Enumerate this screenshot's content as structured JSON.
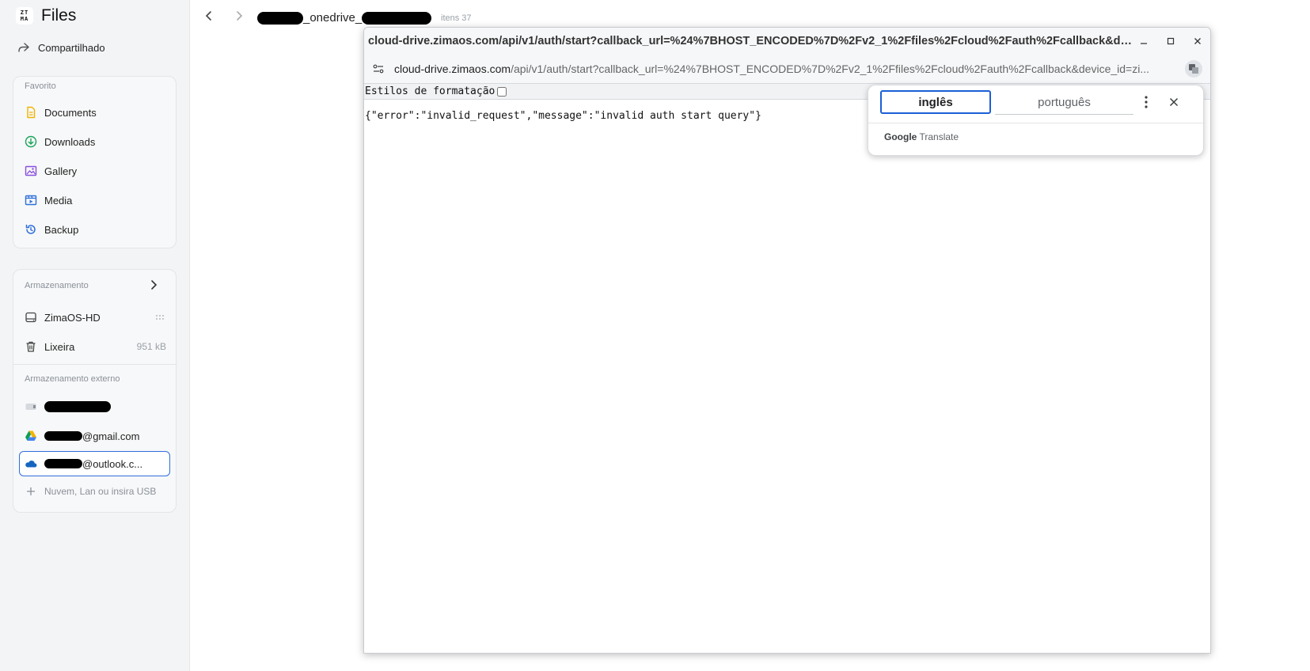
{
  "app": {
    "title": "Files",
    "logo_text_top": "ZT",
    "logo_text_bottom": "MA"
  },
  "sidebar": {
    "shared_label": "Compartilhado",
    "favorites": {
      "title": "Favorito",
      "items": [
        {
          "label": "Documents",
          "icon": "document-icon",
          "color": "#f0b400"
        },
        {
          "label": "Downloads",
          "icon": "download-icon",
          "color": "#19a45a"
        },
        {
          "label": "Gallery",
          "icon": "image-icon",
          "color": "#8a4fe0"
        },
        {
          "label": "Media",
          "icon": "media-icon",
          "color": "#2f6fdc"
        },
        {
          "label": "Backup",
          "icon": "backup-icon",
          "color": "#2f6fdc"
        }
      ]
    },
    "storage": {
      "title": "Armazenamento",
      "items": [
        {
          "label": "ZimaOS-HD",
          "icon": "drive-icon"
        },
        {
          "label": "Lixeira",
          "icon": "trash-icon",
          "size": "951 kB"
        }
      ],
      "external_title": "Armazenamento externo",
      "external": [
        {
          "label": "",
          "icon": "usb-drive-icon"
        },
        {
          "label": "@gmail.com",
          "icon": "google-drive-icon"
        },
        {
          "label": "@outlook.c...",
          "icon": "onedrive-icon"
        }
      ],
      "add_label": "Nuvem, Lan ou insira USB"
    }
  },
  "header": {
    "breadcrumb_text": "_onedrive_",
    "item_count": "itens 37"
  },
  "popup": {
    "title": "cloud-drive.zimaos.com/api/v1/auth/start?callback_url=%24%7BHOST_ENCODED%7D%2Fv2_1%2Ffiles%2Fcloud%2Fauth%2Fcallback&device_id=zi...",
    "url_host": "cloud-drive.zimaos.com",
    "url_path": "/api/v1/auth/start?callback_url=%24%7BHOST_ENCODED%7D%2Fv2_1%2Ffiles%2Fcloud%2Fauth%2Fcallback&device_id=zi...",
    "pretty_print_label": "Estilos de formatação",
    "body_text": "{\"error\":\"invalid_request\",\"message\":\"invalid auth start query\"}"
  },
  "translate": {
    "source_lang": "inglês",
    "target_lang": "português",
    "brand_google": "Google",
    "brand_translate": "Translate"
  }
}
